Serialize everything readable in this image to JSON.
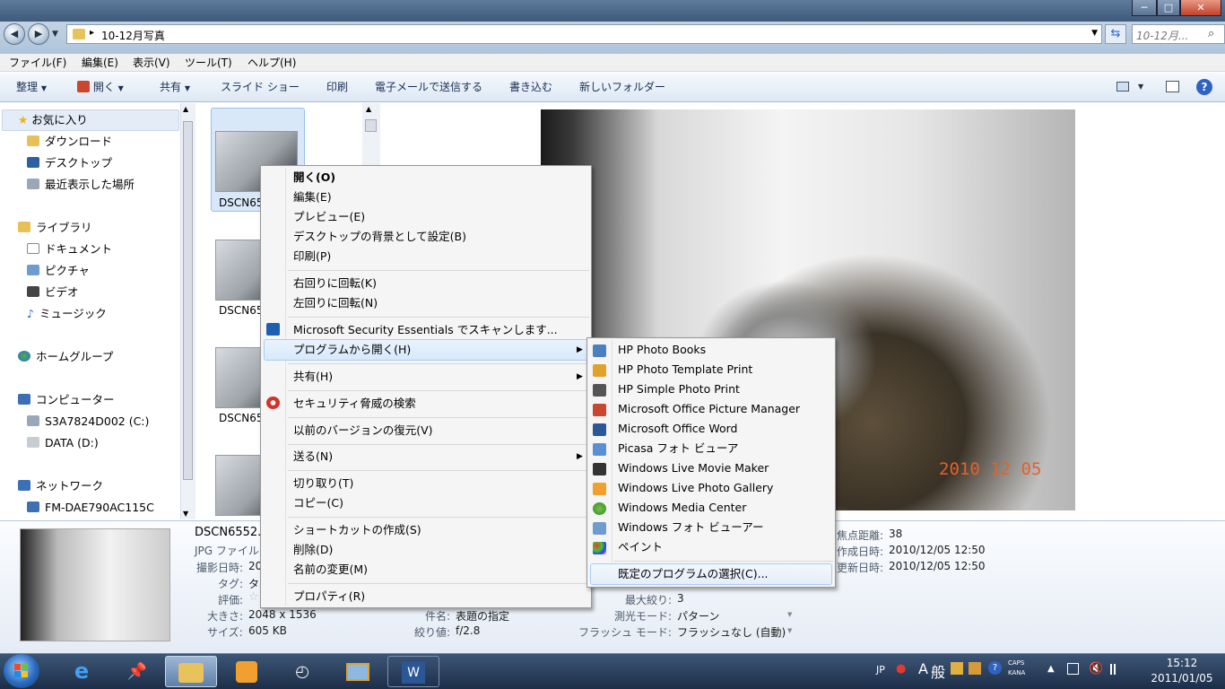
{
  "window": {
    "title_buttons": [
      "─",
      "□",
      "✕"
    ]
  },
  "address": {
    "path": "10-12月写真",
    "search_placeholder": "10-12月..."
  },
  "menubar": [
    "ファイル(F)",
    "編集(E)",
    "表示(V)",
    "ツール(T)",
    "ヘルプ(H)"
  ],
  "toolbar": {
    "organize": "整理",
    "open": "開く",
    "share": "共有",
    "slideshow": "スライド ショー",
    "print": "印刷",
    "email": "電子メールで送信する",
    "burn": "書き込む",
    "new_folder": "新しいフォルダー"
  },
  "nav": {
    "favorites": "お気に入り",
    "downloads": "ダウンロード",
    "desktop": "デスクトップ",
    "recent": "最近表示した場所",
    "libraries": "ライブラリ",
    "documents": "ドキュメント",
    "pictures": "ピクチャ",
    "videos": "ビデオ",
    "music": "ミュージック",
    "homegroup": "ホームグループ",
    "computer": "コンピューター",
    "drive_c": "S3A7824D002 (C:)",
    "drive_d": "DATA (D:)",
    "network": "ネットワーク",
    "network_pc": "FM-DAE790AC115C"
  },
  "files": [
    "DSCN65",
    "DSCN65",
    "DSCN65"
  ],
  "photo": {
    "date_stamp": "2010 12 05"
  },
  "details": {
    "filename": "DSCN6552.",
    "filetype": "JPG ファイル",
    "date_taken_label": "撮影日時:",
    "date_taken_value": "20",
    "tags_label": "タグ:",
    "tags_value": "タ",
    "rating_label": "評価:",
    "dimensions_label": "大きさ:",
    "dimensions_value": "2048 x 1536",
    "size_label": "サイズ:",
    "size_value": "605 KB",
    "title_label": "件名:",
    "title_value": "表題の指定",
    "fstop_label": "絞り値:",
    "fstop_value": "f/2.8",
    "max_aperture_label": "最大絞り:",
    "max_aperture_value": "3",
    "metering_label": "測光モード:",
    "metering_value": "パターン",
    "flash_label": "フラッシュ モード:",
    "flash_value": "フラッシュなし (自動)",
    "focal_label": "焦点距離:",
    "focal_value": "38",
    "created_label": "作成日時:",
    "created_value": "2010/12/05 12:50",
    "modified_label": "更新日時:",
    "modified_value": "2010/12/05 12:50"
  },
  "context_menu": [
    "開く(O)",
    "編集(E)",
    "プレビュー(E)",
    "デスクトップの背景として設定(B)",
    "印刷(P)",
    "右回りに回転(K)",
    "左回りに回転(N)",
    "Microsoft Security Essentials でスキャンします...",
    "プログラムから開く(H)",
    "共有(H)",
    "セキュリティ脅威の検索",
    "以前のバージョンの復元(V)",
    "送る(N)",
    "切り取り(T)",
    "コピー(C)",
    "ショートカットの作成(S)",
    "削除(D)",
    "名前の変更(M)",
    "プロパティ(R)"
  ],
  "open_with": [
    "HP Photo Books",
    "HP Photo Template Print",
    "HP Simple Photo Print",
    "Microsoft Office Picture Manager",
    "Microsoft Office Word",
    "Picasa フォト ビューア",
    "Windows Live Movie Maker",
    "Windows Live Photo Gallery",
    "Windows Media Center",
    "Windows フォト ビューアー",
    "ペイント",
    "既定のプログラムの選択(C)..."
  ],
  "tray": {
    "lang": "JP",
    "ime": "般",
    "ime_a": "A",
    "caps": "CAPS",
    "kana": "KANA"
  },
  "clock": {
    "time": "15:12",
    "date": "2011/01/05"
  },
  "colors": {
    "accent": "#a8cdf3",
    "taskbar": "#1c2e48",
    "date_stamp": "#e2622a"
  }
}
